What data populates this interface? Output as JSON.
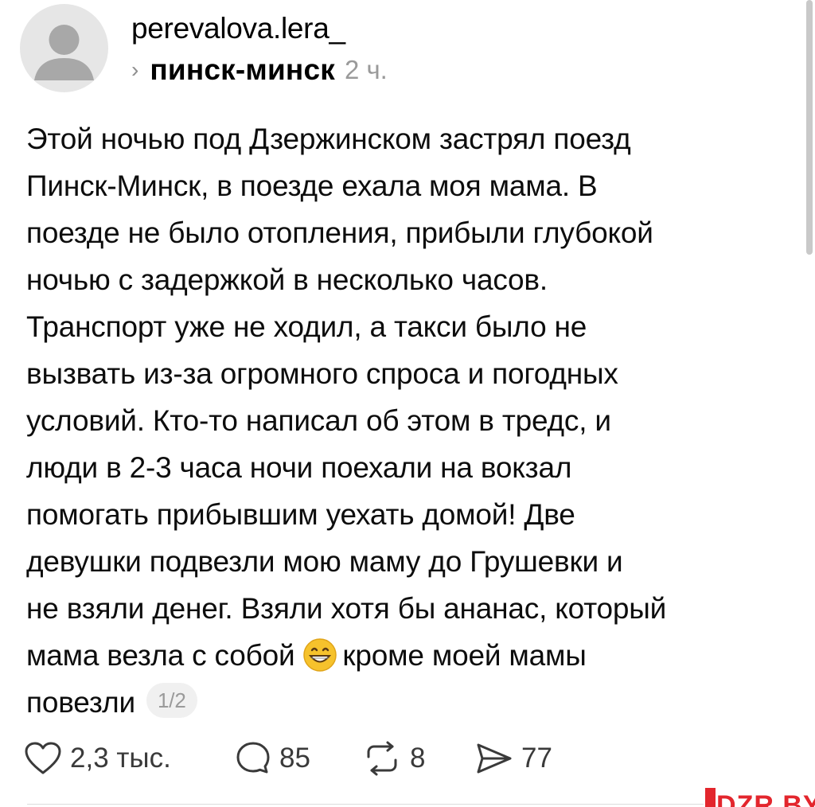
{
  "post": {
    "username": "perevalova.lera_",
    "topic": "пинск-минск",
    "time": "2 ч.",
    "lines": [
      "Этой ночью под Дзержинском застрял поезд",
      "Пинск-Минск, в поезде ехала моя мама. В",
      "поезде не было отопления, прибыли глубокой",
      "ночью с задержкой в несколько часов.",
      "Транспорт уже не ходил, а такси было не",
      "вызвать из-за огромного спроса и погодных",
      "условий. Кто-то написал об этом в тредс, и",
      "люди в 2-3 часа ночи поехали на вокзал",
      "помогать прибывшим уехать домой! Две",
      "девушки подвезли мою маму до Грушевки и",
      "не взяли денег. Взяли хотя бы ананас, который"
    ],
    "line12_before_emoji": "мама везла с собой",
    "line12_after_emoji": "кроме моей мамы",
    "last_line": "повезли",
    "pager": "1/2",
    "emoji": "grinning-face-emoji"
  },
  "actions": {
    "likes": "2,3 тыс.",
    "replies": "85",
    "reposts": "8",
    "shares": "77"
  },
  "watermark": {
    "text": "DZR.BY",
    "color": "#e3262d"
  },
  "icons": [
    "avatar-placeholder-icon",
    "chevron-right-icon",
    "heart-icon",
    "comment-icon",
    "repost-icon",
    "share-icon"
  ]
}
